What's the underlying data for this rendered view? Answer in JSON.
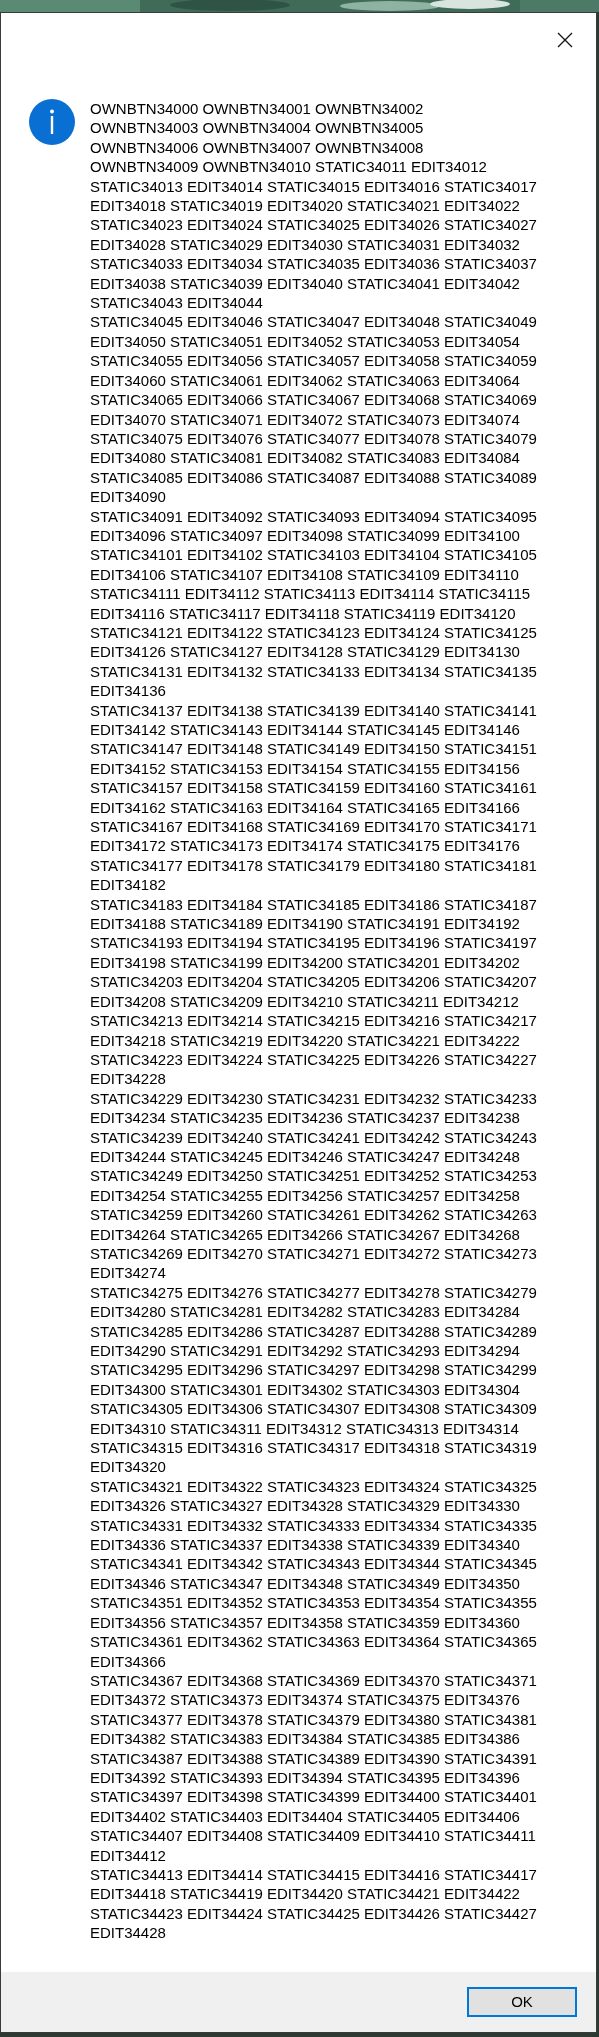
{
  "message": {
    "lines": [
      "OWNBTN34000 OWNBTN34001 OWNBTN34002",
      "OWNBTN34003 OWNBTN34004 OWNBTN34005",
      "OWNBTN34006 OWNBTN34007 OWNBTN34008",
      "OWNBTN34009 OWNBTN34010 STATIC34011 EDIT34012",
      "STATIC34013 EDIT34014 STATIC34015 EDIT34016 STATIC34017",
      "EDIT34018 STATIC34019 EDIT34020 STATIC34021 EDIT34022",
      "STATIC34023 EDIT34024 STATIC34025 EDIT34026 STATIC34027",
      "EDIT34028 STATIC34029 EDIT34030 STATIC34031 EDIT34032",
      "STATIC34033 EDIT34034 STATIC34035 EDIT34036 STATIC34037",
      "EDIT34038 STATIC34039 EDIT34040 STATIC34041 EDIT34042",
      "STATIC34043 EDIT34044",
      "STATIC34045 EDIT34046 STATIC34047 EDIT34048 STATIC34049",
      "EDIT34050 STATIC34051 EDIT34052 STATIC34053 EDIT34054",
      "STATIC34055 EDIT34056 STATIC34057 EDIT34058 STATIC34059",
      "EDIT34060 STATIC34061 EDIT34062 STATIC34063 EDIT34064",
      "STATIC34065 EDIT34066 STATIC34067 EDIT34068 STATIC34069",
      "EDIT34070 STATIC34071 EDIT34072 STATIC34073 EDIT34074",
      "STATIC34075 EDIT34076 STATIC34077 EDIT34078 STATIC34079",
      "EDIT34080 STATIC34081 EDIT34082 STATIC34083 EDIT34084",
      "STATIC34085 EDIT34086 STATIC34087 EDIT34088 STATIC34089",
      "EDIT34090",
      "STATIC34091 EDIT34092 STATIC34093 EDIT34094 STATIC34095",
      "EDIT34096 STATIC34097 EDIT34098 STATIC34099 EDIT34100",
      "STATIC34101 EDIT34102 STATIC34103 EDIT34104 STATIC34105",
      "EDIT34106 STATIC34107 EDIT34108 STATIC34109 EDIT34110",
      "STATIC34111 EDIT34112 STATIC34113 EDIT34114 STATIC34115",
      "EDIT34116 STATIC34117 EDIT34118 STATIC34119 EDIT34120",
      "STATIC34121 EDIT34122 STATIC34123 EDIT34124 STATIC34125",
      "EDIT34126 STATIC34127 EDIT34128 STATIC34129 EDIT34130",
      "STATIC34131 EDIT34132 STATIC34133 EDIT34134 STATIC34135",
      "EDIT34136",
      "STATIC34137 EDIT34138 STATIC34139 EDIT34140 STATIC34141",
      "EDIT34142 STATIC34143 EDIT34144 STATIC34145 EDIT34146",
      "STATIC34147 EDIT34148 STATIC34149 EDIT34150 STATIC34151",
      "EDIT34152 STATIC34153 EDIT34154 STATIC34155 EDIT34156",
      "STATIC34157 EDIT34158 STATIC34159 EDIT34160 STATIC34161",
      "EDIT34162 STATIC34163 EDIT34164 STATIC34165 EDIT34166",
      "STATIC34167 EDIT34168 STATIC34169 EDIT34170 STATIC34171",
      "EDIT34172 STATIC34173 EDIT34174 STATIC34175 EDIT34176",
      "STATIC34177 EDIT34178 STATIC34179 EDIT34180 STATIC34181",
      "EDIT34182",
      "STATIC34183 EDIT34184 STATIC34185 EDIT34186 STATIC34187",
      "EDIT34188 STATIC34189 EDIT34190 STATIC34191 EDIT34192",
      "STATIC34193 EDIT34194 STATIC34195 EDIT34196 STATIC34197",
      "EDIT34198 STATIC34199 EDIT34200 STATIC34201 EDIT34202",
      "STATIC34203 EDIT34204 STATIC34205 EDIT34206 STATIC34207",
      "EDIT34208 STATIC34209 EDIT34210 STATIC34211 EDIT34212",
      "STATIC34213 EDIT34214 STATIC34215 EDIT34216 STATIC34217",
      "EDIT34218 STATIC34219 EDIT34220 STATIC34221 EDIT34222",
      "STATIC34223 EDIT34224 STATIC34225 EDIT34226 STATIC34227",
      "EDIT34228",
      "STATIC34229 EDIT34230 STATIC34231 EDIT34232 STATIC34233",
      "EDIT34234 STATIC34235 EDIT34236 STATIC34237 EDIT34238",
      "STATIC34239 EDIT34240 STATIC34241 EDIT34242 STATIC34243",
      "EDIT34244 STATIC34245 EDIT34246 STATIC34247 EDIT34248",
      "STATIC34249 EDIT34250 STATIC34251 EDIT34252 STATIC34253",
      "EDIT34254 STATIC34255 EDIT34256 STATIC34257 EDIT34258",
      "STATIC34259 EDIT34260 STATIC34261 EDIT34262 STATIC34263",
      "EDIT34264 STATIC34265 EDIT34266 STATIC34267 EDIT34268",
      "STATIC34269 EDIT34270 STATIC34271 EDIT34272 STATIC34273",
      "EDIT34274",
      "STATIC34275 EDIT34276 STATIC34277 EDIT34278 STATIC34279",
      "EDIT34280 STATIC34281 EDIT34282 STATIC34283 EDIT34284",
      "STATIC34285 EDIT34286 STATIC34287 EDIT34288 STATIC34289",
      "EDIT34290 STATIC34291 EDIT34292 STATIC34293 EDIT34294",
      "STATIC34295 EDIT34296 STATIC34297 EDIT34298 STATIC34299",
      "EDIT34300 STATIC34301 EDIT34302 STATIC34303 EDIT34304",
      "STATIC34305 EDIT34306 STATIC34307 EDIT34308 STATIC34309",
      "EDIT34310 STATIC34311 EDIT34312 STATIC34313 EDIT34314",
      "STATIC34315 EDIT34316 STATIC34317 EDIT34318 STATIC34319",
      "EDIT34320",
      "STATIC34321 EDIT34322 STATIC34323 EDIT34324 STATIC34325",
      "EDIT34326 STATIC34327 EDIT34328 STATIC34329 EDIT34330",
      "STATIC34331 EDIT34332 STATIC34333 EDIT34334 STATIC34335",
      "EDIT34336 STATIC34337 EDIT34338 STATIC34339 EDIT34340",
      "STATIC34341 EDIT34342 STATIC34343 EDIT34344 STATIC34345",
      "EDIT34346 STATIC34347 EDIT34348 STATIC34349 EDIT34350",
      "STATIC34351 EDIT34352 STATIC34353 EDIT34354 STATIC34355",
      "EDIT34356 STATIC34357 EDIT34358 STATIC34359 EDIT34360",
      "STATIC34361 EDIT34362 STATIC34363 EDIT34364 STATIC34365",
      "EDIT34366",
      "STATIC34367 EDIT34368 STATIC34369 EDIT34370 STATIC34371",
      "EDIT34372 STATIC34373 EDIT34374 STATIC34375 EDIT34376",
      "STATIC34377 EDIT34378 STATIC34379 EDIT34380 STATIC34381",
      "EDIT34382 STATIC34383 EDIT34384 STATIC34385 EDIT34386",
      "STATIC34387 EDIT34388 STATIC34389 EDIT34390 STATIC34391",
      "EDIT34392 STATIC34393 EDIT34394 STATIC34395 EDIT34396",
      "STATIC34397 EDIT34398 STATIC34399 EDIT34400 STATIC34401",
      "EDIT34402 STATIC34403 EDIT34404 STATIC34405 EDIT34406",
      "STATIC34407 EDIT34408 STATIC34409 EDIT34410 STATIC34411",
      "EDIT34412",
      "STATIC34413 EDIT34414 STATIC34415 EDIT34416 STATIC34417",
      "EDIT34418 STATIC34419 EDIT34420 STATIC34421 EDIT34422",
      "STATIC34423 EDIT34424 STATIC34425 EDIT34426 STATIC34427",
      "EDIT34428"
    ]
  },
  "buttons": [
    {
      "label": "OK",
      "focused": true
    }
  ]
}
